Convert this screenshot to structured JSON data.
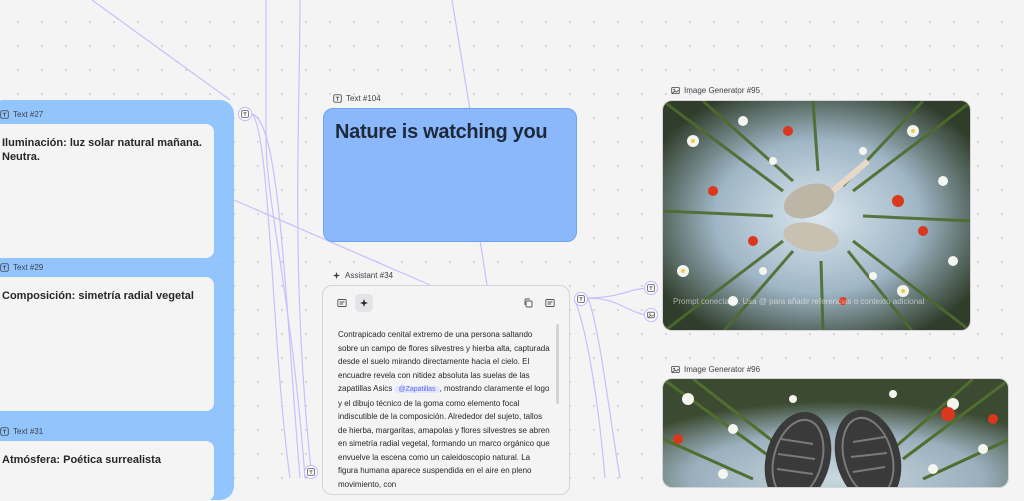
{
  "nodes": {
    "text27": {
      "label": "Text #27",
      "content": "Iluminación: luz solar natural mañana. Neutra."
    },
    "text29": {
      "label": "Text #29",
      "content": "Composición: simetría radial vegetal"
    },
    "text31": {
      "label": "Text #31",
      "content": "Atmósfera: Poética surrealista"
    },
    "text104": {
      "label": "Text #104",
      "content": "Nature is watching you"
    },
    "assistant34": {
      "label": "Assistant #34",
      "text_before_chip": "Contrapicado cenital extremo de una persona saltando sobre un campo de flores silvestres y hierba alta, capturada desde el suelo mirando directamente hacia el cielo. El encuadre revela con nitidez absoluta las suelas de las zapatillas Asics",
      "chip": "@Zapatillas",
      "text_after_chip": ", mostrando claramente el logo y el dibujo técnico de la goma como elemento focal indiscutible de la composición. Alrededor del sujeto, tallos de hierba, margaritas, amapolas y flores silvestres se abren en simetría radial vegetal, formando un marco orgánico que envuelve la escena como un caleidoscopio natural. La figura humana aparece suspendida en el aire en pleno movimiento, con"
    },
    "img95": {
      "label": "Image Generator #95",
      "prompt_placeholder": "Prompt conectado. Usa @ para añadir referencias o contexto adicional"
    },
    "img96": {
      "label": "Image Generator #96"
    }
  },
  "colors": {
    "canvas": "#f4f4f5",
    "group_blue": "#93c5fd",
    "node_blue": "#8bb8fb",
    "wire": "#c4b5fd",
    "chip_bg": "#e0e7ff",
    "chip_text": "#6366f1"
  },
  "icons": {
    "text_node": "text-square-icon",
    "assistant_node": "sparkle-icon",
    "image_node": "image-icon",
    "copy": "copy-icon"
  }
}
